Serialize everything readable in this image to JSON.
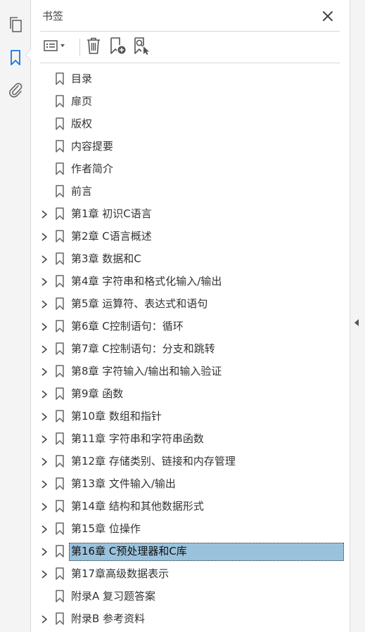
{
  "panel": {
    "title": "书签"
  },
  "rail": {
    "items": [
      {
        "name": "page-thumbnails-icon"
      },
      {
        "name": "bookmark-icon",
        "active": true
      },
      {
        "name": "attachment-icon"
      }
    ]
  },
  "toolbar": {
    "buttons": [
      "options-menu-icon",
      "delete-bookmark-icon",
      "new-bookmark-icon",
      "find-current-bookmark-icon"
    ]
  },
  "bookmarks": [
    {
      "label": "目录",
      "expandable": false
    },
    {
      "label": "扉页",
      "expandable": false
    },
    {
      "label": "版权",
      "expandable": false
    },
    {
      "label": "内容提要",
      "expandable": false
    },
    {
      "label": "作者简介",
      "expandable": false
    },
    {
      "label": "前言",
      "expandable": false
    },
    {
      "label": "第1章 初识C语言",
      "expandable": true
    },
    {
      "label": "第2章 C语言概述",
      "expandable": true
    },
    {
      "label": "第3章 数据和C",
      "expandable": true
    },
    {
      "label": "第4章 字符串和格式化输入/输出",
      "expandable": true
    },
    {
      "label": "第5章 运算符、表达式和语句",
      "expandable": true
    },
    {
      "label": "第6章 C控制语句：循环",
      "expandable": true
    },
    {
      "label": "第7章 C控制语句：分支和跳转",
      "expandable": true
    },
    {
      "label": "第8章 字符输入/输出和输入验证",
      "expandable": true
    },
    {
      "label": "第9章 函数",
      "expandable": true
    },
    {
      "label": "第10章 数组和指针",
      "expandable": true
    },
    {
      "label": "第11章 字符串和字符串函数",
      "expandable": true
    },
    {
      "label": "第12章 存储类别、链接和内存管理",
      "expandable": true
    },
    {
      "label": "第13章 文件输入/输出",
      "expandable": true
    },
    {
      "label": "第14章 结构和其他数据形式",
      "expandable": true
    },
    {
      "label": "第15章 位操作",
      "expandable": true
    },
    {
      "label": "第16章 C预处理器和C库",
      "expandable": true,
      "selected": true
    },
    {
      "label": "第17章高级数据表示",
      "expandable": true
    },
    {
      "label": "附录A 复习题答案",
      "expandable": false
    },
    {
      "label": "附录B 参考资料",
      "expandable": true
    }
  ],
  "colors": {
    "selection": "#9ac2dc",
    "accent": "#1473e6"
  }
}
